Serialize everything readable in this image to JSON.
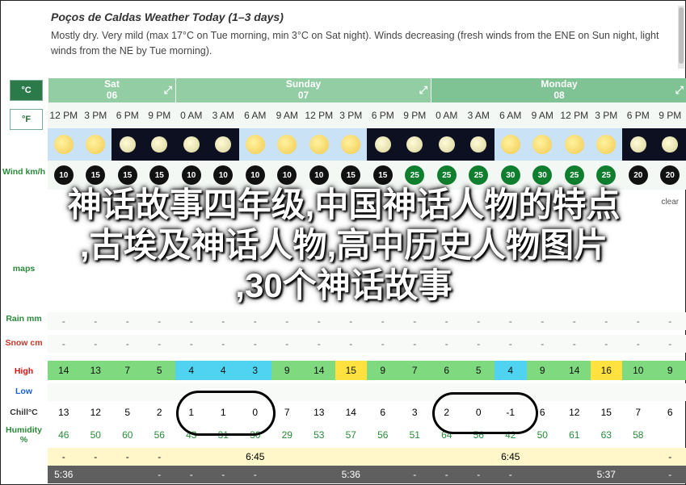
{
  "header": {
    "title": "Poços de Caldas Weather Today (1–3 days)",
    "description": "Mostly dry. Very mild (max 17°C on Tue morning, min 3°C on Sat night). Winds decreasing (fresh winds from the ENE on Sun night, light winds from the NE by Tue morning)."
  },
  "units": {
    "celsius": "°C",
    "fahrenheit": "°F"
  },
  "labels": {
    "wind": "Wind km/h",
    "rain": "Rain mm",
    "snow": "Snow cm",
    "high": "High",
    "low": "Low",
    "chill": "Chill°C",
    "humidity": "Humidity %",
    "maps": "maps"
  },
  "days": [
    {
      "name": "Sat",
      "date": "06"
    },
    {
      "name": "Sunday",
      "date": "07"
    },
    {
      "name": "Monday",
      "date": "08"
    }
  ],
  "times": [
    "12 PM",
    "3 PM",
    "6 PM",
    "9 PM",
    "0 AM",
    "3 AM",
    "6 AM",
    "9 AM",
    "12 PM",
    "3 PM",
    "6 PM",
    "9 PM",
    "0 AM",
    "3 AM",
    "6 AM",
    "9 AM",
    "12 PM",
    "3 PM",
    "6 PM",
    "9 PM"
  ],
  "wind": [
    "10",
    "15",
    "15",
    "15",
    "10",
    "10",
    "10",
    "10",
    "10",
    "15",
    "15",
    "25",
    "25",
    "25",
    "30",
    "30",
    "25",
    "25",
    "20",
    "20"
  ],
  "conditions": [
    "",
    "",
    "",
    "",
    "",
    "",
    "",
    "",
    "",
    "",
    "",
    "",
    "",
    "",
    "",
    "",
    "",
    "",
    "",
    "clear"
  ],
  "rain": [
    "-",
    "-",
    "-",
    "-",
    "-",
    "-",
    "-",
    "-",
    "-",
    "-",
    "-",
    "-",
    "-",
    "-",
    "-",
    "-",
    "-",
    "-",
    "-",
    "-"
  ],
  "snow": [
    "-",
    "-",
    "-",
    "-",
    "-",
    "-",
    "-",
    "-",
    "-",
    "-",
    "-",
    "-",
    "-",
    "-",
    "-",
    "-",
    "-",
    "-",
    "-",
    "-"
  ],
  "high": [
    "14",
    "13",
    "7",
    "5",
    "4",
    "4",
    "3",
    "9",
    "14",
    "15",
    "9",
    "7",
    "6",
    "5",
    "4",
    "9",
    "14",
    "16",
    "10",
    "9"
  ],
  "low": [
    "",
    "",
    "",
    "",
    "",
    "",
    "",
    "",
    "",
    "",
    "",
    "",
    "",
    "",
    "",
    "",
    "",
    "",
    "",
    ""
  ],
  "chill": [
    "13",
    "12",
    "5",
    "2",
    "1",
    "1",
    "0",
    "7",
    "13",
    "14",
    "6",
    "3",
    "2",
    "0",
    "-1",
    "6",
    "12",
    "15",
    "7",
    "6"
  ],
  "humidity": [
    "46",
    "50",
    "60",
    "56",
    "43",
    "31",
    "30",
    "29",
    "53",
    "57",
    "56",
    "51",
    "64",
    "56",
    "42",
    "50",
    "61",
    "63",
    "58",
    ""
  ],
  "sunrise": [
    "-",
    "-",
    "-",
    "-",
    "",
    "",
    "6:45",
    "",
    "",
    "",
    "",
    "",
    "",
    "",
    "6:45",
    "",
    "",
    "",
    "",
    "-"
  ],
  "sunset": [
    "5:36",
    "",
    "",
    "-",
    "-",
    "-",
    "-",
    "",
    "",
    "5:36",
    "",
    "-",
    "-",
    "-",
    "-",
    "",
    "",
    "5:37",
    "",
    "-"
  ],
  "overlay": {
    "line1": "神话故事四年级,中国神话人物的特点",
    "line2": ",古埃及神话人物,高中历史人物图片",
    "line3": ",30个神话故事"
  }
}
